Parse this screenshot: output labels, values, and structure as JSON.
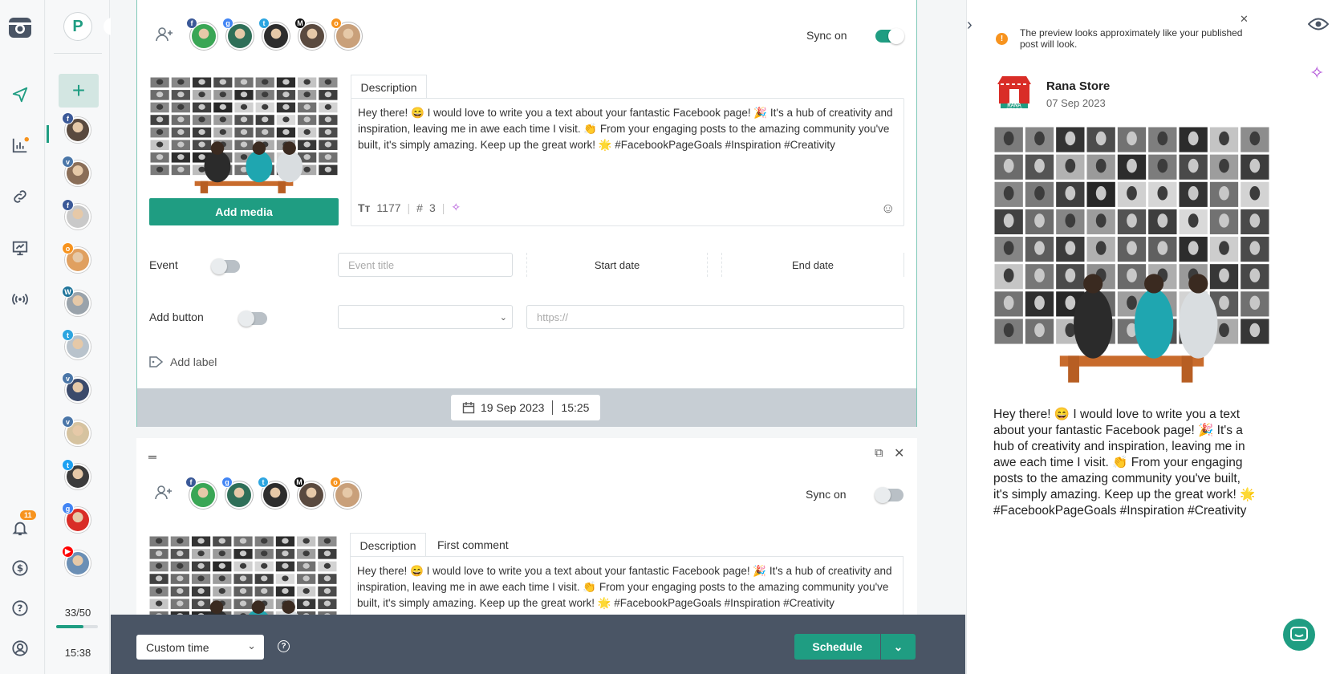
{
  "sidebar": {
    "profile_letter": "P",
    "notifications_count": "11",
    "usage": "33/50",
    "usage_fraction": 0.66,
    "time": "15:38",
    "icons": [
      "camera-logo-icon",
      "send-icon",
      "analytics-icon",
      "link-icon",
      "monitor-icon",
      "broadcast-icon",
      "bell-icon",
      "dollar-icon",
      "help-icon",
      "user-icon"
    ]
  },
  "accounts": {
    "list": [
      {
        "network": "facebook",
        "color": "#3b5998",
        "letter": "f"
      },
      {
        "network": "vk",
        "color": "#4a76a8",
        "letter": "vk"
      },
      {
        "network": "facebook",
        "color": "#3b5998",
        "letter": "f"
      },
      {
        "network": "odnoklassniki",
        "color": "#f7931e",
        "letter": "ok"
      },
      {
        "network": "wordpress",
        "color": "#21759b",
        "letter": "W"
      },
      {
        "network": "telegram",
        "color": "#2ca5e0",
        "letter": "t"
      },
      {
        "network": "vk",
        "color": "#4a76a8",
        "letter": "vk"
      },
      {
        "network": "vk",
        "color": "#4a76a8",
        "letter": "vk"
      },
      {
        "network": "twitter",
        "color": "#1da1f2",
        "letter": "t"
      },
      {
        "network": "google-business",
        "color": "#4285f4",
        "letter": "g"
      },
      {
        "network": "youtube",
        "color": "#ff0000",
        "letter": "▶"
      }
    ]
  },
  "post1": {
    "sync_label": "Sync on",
    "sync_on": true,
    "tab_description": "Description",
    "text": "Hey there! 😄 I would love to write you a text about your fantastic Facebook page! 🎉 It's a hub of creativity and inspiration, leaving me in awe each time I visit. 👏 From your engaging posts to the amazing community you've built, it's simply amazing. Keep up the great work! 🌟 #FacebookPageGoals #Inspiration #Creativity",
    "char_count": "1177",
    "hashtag_count": "3",
    "add_media": "Add media",
    "event_label": "Event",
    "event_title_placeholder": "Event title",
    "start_date": "Start date",
    "end_date": "End date",
    "add_button_label": "Add button",
    "url_placeholder": "https://",
    "add_label": "Add label",
    "date": "19 Sep 2023",
    "time": "15:25"
  },
  "post2": {
    "sync_label": "Sync on",
    "sync_on": false,
    "tab_description": "Description",
    "tab_first_comment": "First comment",
    "text": "Hey there! 😄 I would love to write you a text about your fantastic Facebook page! 🎉 It's a hub of creativity and inspiration, leaving me in awe each time I visit. 👏 From your engaging posts to the amazing community you've built, it's simply amazing. Keep up the great work! 🌟 #FacebookPageGoals #Inspiration #Creativity"
  },
  "footer": {
    "time_mode": "Custom time",
    "schedule": "Schedule"
  },
  "preview": {
    "notice": "The preview looks approximately like your published post will look.",
    "page_name": "Rana Store",
    "logo_text": "RANA STORE",
    "date": "07 Sep 2023",
    "text": "Hey there! 😄 I would love to write you a text about your fantastic Facebook page! 🎉 It's a hub of creativity and inspiration, leaving me in awe each time I visit. 👏 From your engaging posts to the amazing community you've built, it's simply amazing. Keep up the great work! 🌟 #FacebookPageGoals #Inspiration #Creativity"
  },
  "colors": {
    "accent": "#1f9d82",
    "footer_bg": "#4a5565",
    "notification": "#f7931e"
  }
}
